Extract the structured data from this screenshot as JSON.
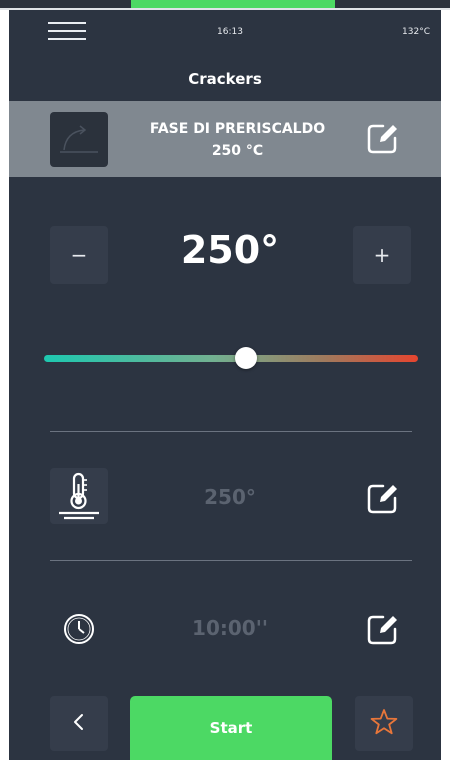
{
  "status_bar": {
    "time": "16:13",
    "oven_temperature": "132°C"
  },
  "recipe": {
    "title": "Crackers"
  },
  "phase": {
    "name": "FASE DI PRERISCALDO",
    "temperature": "250 °C"
  },
  "setpoint": {
    "value": "250°",
    "minus_label": "−",
    "plus_label": "+"
  },
  "slider": {
    "level": 0.54,
    "gradient_start": "#1ec8b0",
    "gradient_end": "#e6452f"
  },
  "probe": {
    "value": "250°",
    "icon": "thermometer-icon"
  },
  "timer": {
    "value": "10:00''",
    "icon": "clock-icon"
  },
  "footer": {
    "start_label": "Start",
    "back_icon": "chevron-left-icon",
    "favorite_icon": "star-icon"
  },
  "colors": {
    "background": "#2c3441",
    "accent_green": "#4cd964",
    "favorite_orange": "#e8763a",
    "phase_band": "#808890"
  }
}
